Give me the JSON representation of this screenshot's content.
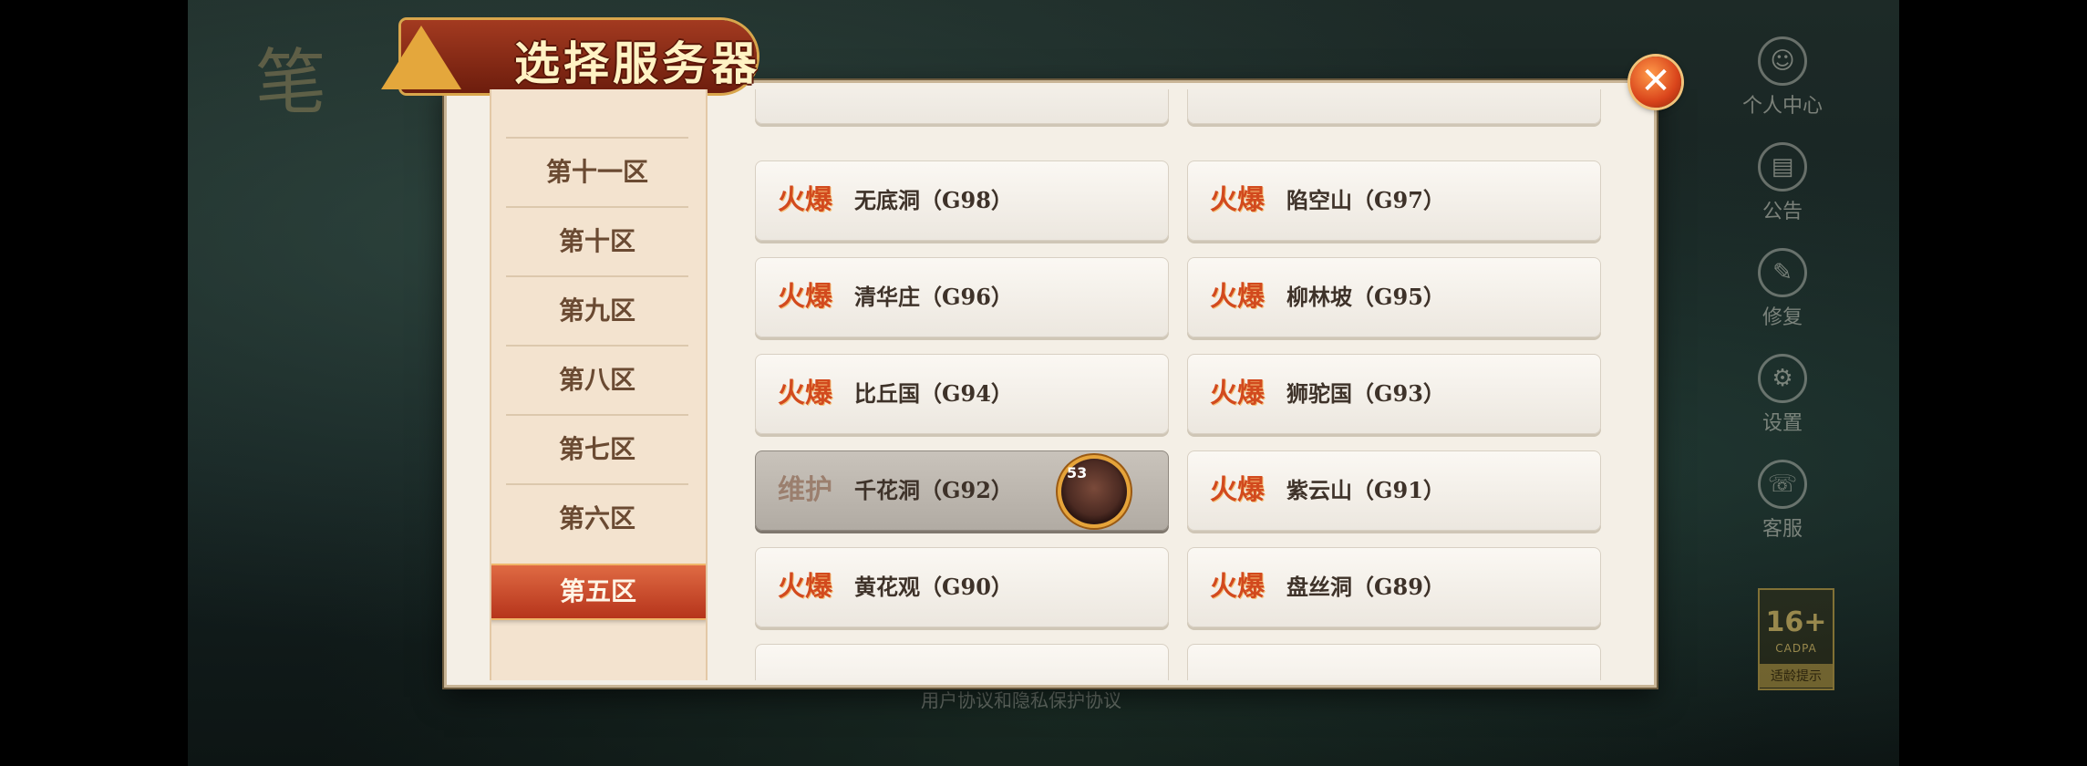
{
  "dialog": {
    "title": "选择服务器",
    "close_symbol": "✕"
  },
  "zones": [
    {
      "label": "第十一区",
      "active": false
    },
    {
      "label": "第十区",
      "active": false
    },
    {
      "label": "第九区",
      "active": false
    },
    {
      "label": "第八区",
      "active": false
    },
    {
      "label": "第七区",
      "active": false
    },
    {
      "label": "第六区",
      "active": false
    },
    {
      "label": "第五区",
      "active": true
    }
  ],
  "servers": [
    {
      "status": "火爆",
      "name": "无底洞（G98）"
    },
    {
      "status": "火爆",
      "name": "陷空山（G97）"
    },
    {
      "status": "火爆",
      "name": "清华庄（G96）"
    },
    {
      "status": "火爆",
      "name": "柳林坡（G95）"
    },
    {
      "status": "火爆",
      "name": "比丘国（G94）"
    },
    {
      "status": "火爆",
      "name": "狮驼国（G93）"
    },
    {
      "status": "维护",
      "name": "千花洞（G92）",
      "maintenance": true,
      "character_level": "53"
    },
    {
      "status": "火爆",
      "name": "紫云山（G91）"
    },
    {
      "status": "火爆",
      "name": "黄花观（G90）"
    },
    {
      "status": "火爆",
      "name": "盘丝洞（G89）"
    }
  ],
  "side_menu": [
    {
      "label": "个人中心",
      "icon": "user-icon"
    },
    {
      "label": "公告",
      "icon": "notice-icon"
    },
    {
      "label": "修复",
      "icon": "repair-icon"
    },
    {
      "label": "设置",
      "icon": "gear-icon"
    },
    {
      "label": "客服",
      "icon": "support-icon"
    }
  ],
  "age_rating": {
    "number": "16+",
    "org": "CADPA",
    "tip": "适龄提示"
  },
  "links": {
    "agreement": "用户协议和隐私保护协议"
  },
  "colors": {
    "accent": "#b6341b",
    "status_hot": "#d24a1e",
    "panel": "#f4efe6"
  }
}
